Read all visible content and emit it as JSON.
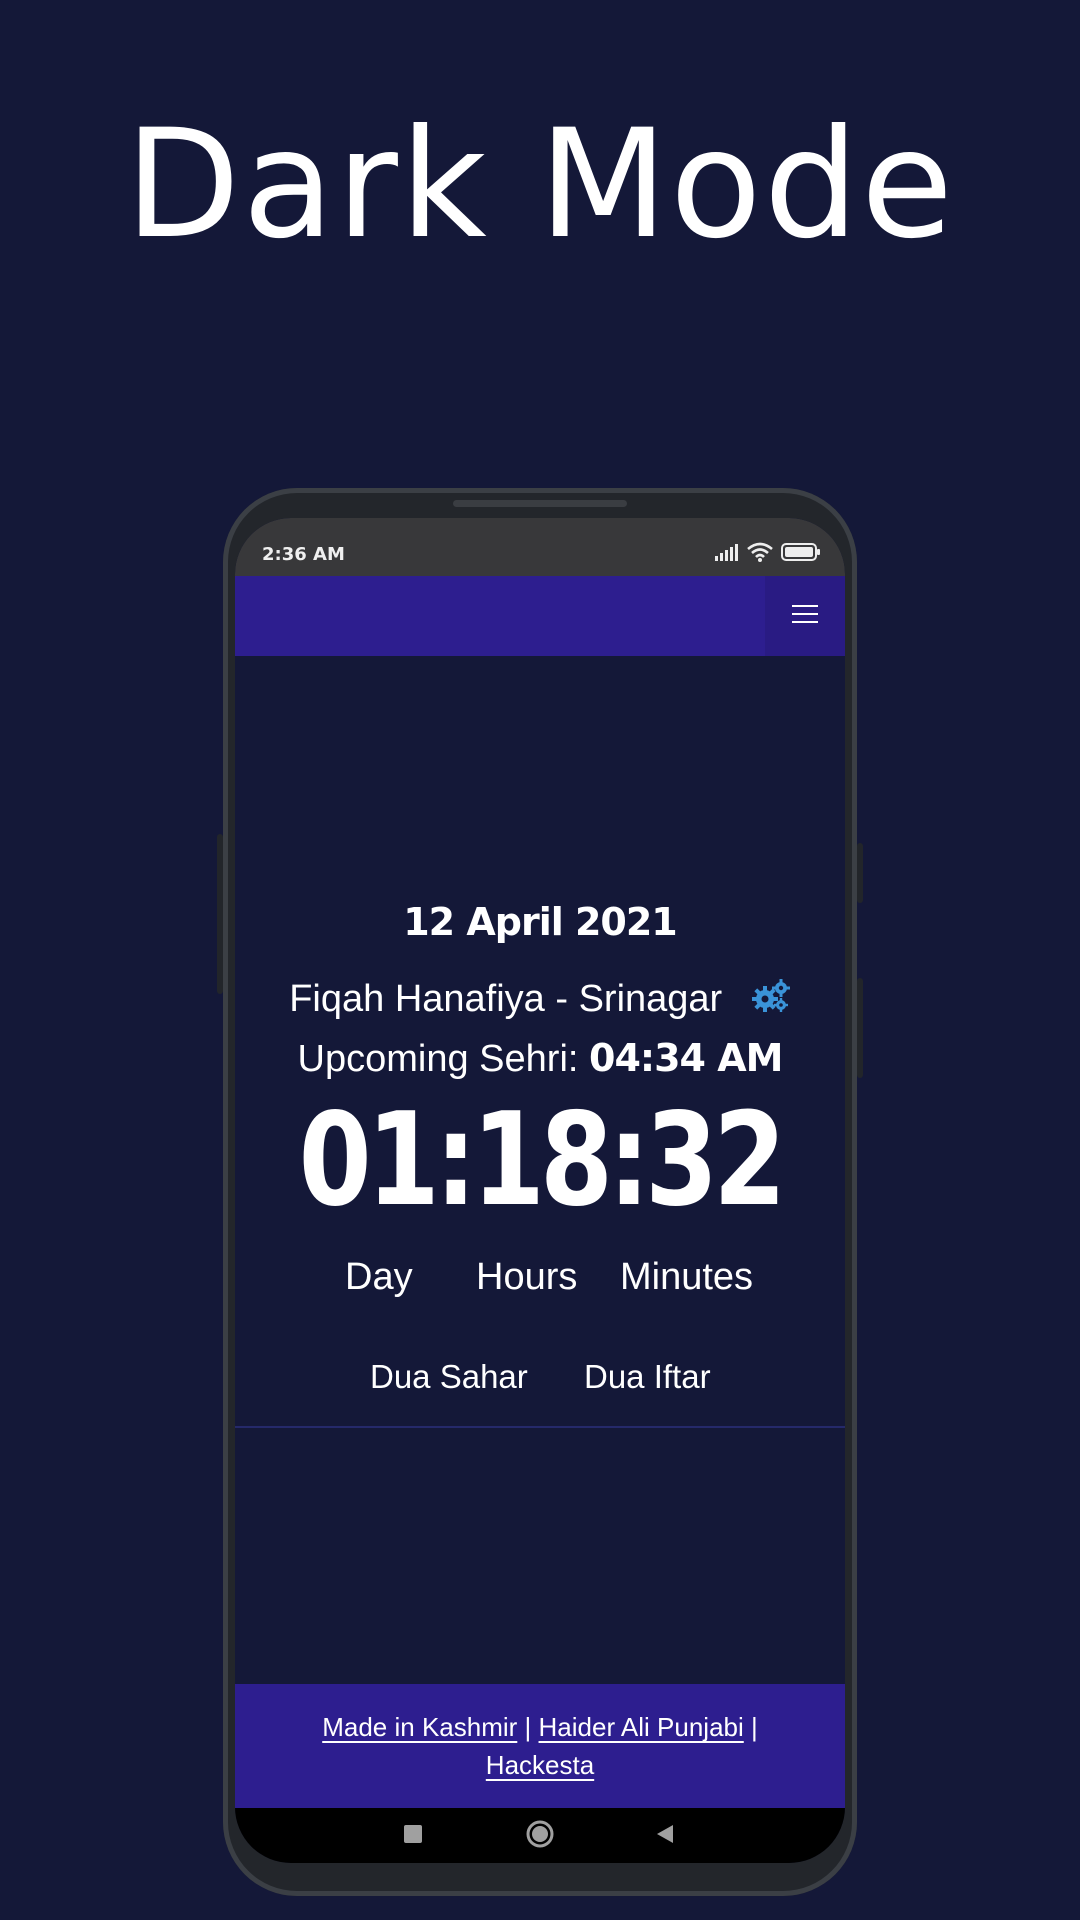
{
  "headline": "Dark Mode",
  "status_bar": {
    "time": "2:36 AM",
    "icons": [
      "signal-icon",
      "wifi-icon",
      "battery-icon"
    ]
  },
  "navbar": {
    "menu_icon": "hamburger-menu-icon"
  },
  "main": {
    "date": "12 April 2021",
    "location": "Fiqah Hanafiya - Srinagar",
    "settings_icon": "gears-icon",
    "upcoming_label": "Upcoming Sehri:",
    "upcoming_time": "04:34 AM",
    "countdown": "01:18:32",
    "units": [
      "Day",
      "Hours",
      "Minutes"
    ],
    "dua_links": [
      "Dua Sahar",
      "Dua Iftar"
    ]
  },
  "footer": {
    "link1": "Made in Kashmir",
    "sep1": "|",
    "link2": "Haider Ali Punjabi",
    "sep2": "|",
    "link3": "Hackesta"
  },
  "system_nav": [
    "recents-square-icon",
    "home-circle-icon",
    "back-triangle-icon"
  ],
  "colors": {
    "background": "#141838",
    "navbar": "#2d1e8f",
    "gear_accent": "#3a93d8"
  }
}
